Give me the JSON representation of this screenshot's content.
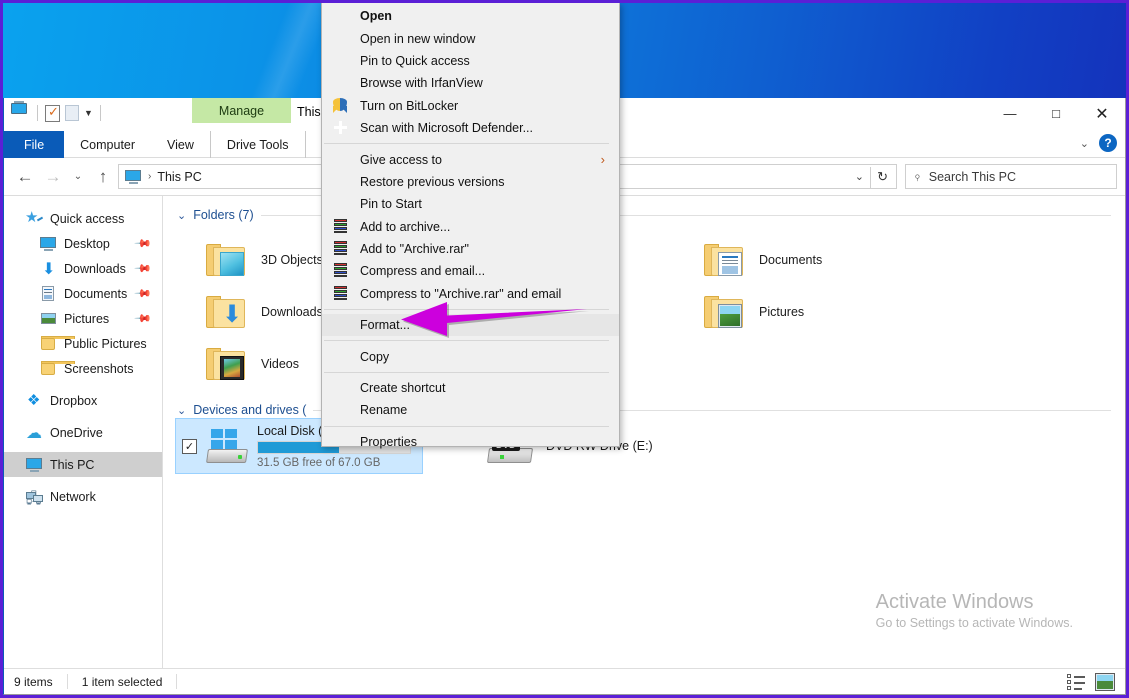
{
  "window": {
    "title": "This PC",
    "title_truncated": "This",
    "contextual_tab_group": "Manage",
    "minimize": "—",
    "maximize": "□",
    "close": "✕",
    "help": "?",
    "ribbon_collapse": "⌄"
  },
  "ribbon": {
    "tabs": [
      {
        "label": "File",
        "id": "file"
      },
      {
        "label": "Computer",
        "id": "computer"
      },
      {
        "label": "View",
        "id": "view"
      },
      {
        "label": "Drive Tools",
        "id": "drive-tools"
      }
    ]
  },
  "quick_access_toolbar": {
    "items": [
      "this-pc-icon",
      "properties-icon",
      "new-folder-icon",
      "customize-chevron-icon"
    ]
  },
  "address_bar": {
    "back": "←",
    "forward": "→",
    "recent": "⌄",
    "up": "↑",
    "crumb_icon": "this-pc-icon",
    "crumb_separator": "›",
    "path": "This PC",
    "dropdown": "⌄",
    "refresh": "↻"
  },
  "search": {
    "icon": "search-icon",
    "placeholder": "Search This PC"
  },
  "sidebar": {
    "items": [
      {
        "label": "Quick access",
        "icon": "star-icon",
        "indent": false,
        "pinned": false,
        "selected": false
      },
      {
        "label": "Desktop",
        "icon": "desktop-icon",
        "indent": true,
        "pinned": true,
        "selected": false
      },
      {
        "label": "Downloads",
        "icon": "download-icon",
        "indent": true,
        "pinned": true,
        "selected": false
      },
      {
        "label": "Documents",
        "icon": "documents-icon",
        "indent": true,
        "pinned": true,
        "selected": false
      },
      {
        "label": "Pictures",
        "icon": "pictures-icon",
        "indent": true,
        "pinned": true,
        "selected": false
      },
      {
        "label": "Public Pictures",
        "icon": "folder-icon",
        "indent": true,
        "pinned": false,
        "selected": false
      },
      {
        "label": "Screenshots",
        "icon": "folder-icon",
        "indent": true,
        "pinned": false,
        "selected": false
      },
      {
        "label": "Dropbox",
        "icon": "dropbox-icon",
        "indent": false,
        "pinned": false,
        "selected": false
      },
      {
        "label": "OneDrive",
        "icon": "onedrive-icon",
        "indent": false,
        "pinned": false,
        "selected": false
      },
      {
        "label": "This PC",
        "icon": "this-pc-icon",
        "indent": false,
        "pinned": false,
        "selected": true
      },
      {
        "label": "Network",
        "icon": "network-icon",
        "indent": false,
        "pinned": false,
        "selected": false
      }
    ],
    "pin_glyph": "📌"
  },
  "content": {
    "groups": [
      {
        "id": "folders",
        "label": "Folders (7)",
        "chevron": "⌄"
      },
      {
        "id": "devices",
        "label": "Devices and drives (",
        "chevron": "⌄"
      }
    ],
    "folders": [
      {
        "label": "3D Objects",
        "icon": "folder-3d-objects-icon"
      },
      {
        "label": "Downloads",
        "icon": "folder-downloads-icon"
      },
      {
        "label": "Videos",
        "icon": "folder-videos-icon"
      },
      {
        "label": "Documents",
        "icon": "folder-documents-icon"
      },
      {
        "label": "Pictures",
        "icon": "folder-pictures-icon"
      }
    ],
    "drives": [
      {
        "name": "Local Disk (",
        "free_text": "31.5 GB free of 67.0 GB",
        "used_percent": 53,
        "selected": true,
        "checkbox": "✓",
        "icon": "hard-disk-icon"
      },
      {
        "name": "DVD RW Drive (E:)",
        "icon": "dvd-drive-icon",
        "badge": "DVD",
        "selected": false
      }
    ]
  },
  "context_menu": {
    "items": [
      {
        "label": "Open",
        "bold": true,
        "icon": null,
        "submenu": false,
        "highlight": false
      },
      {
        "label": "Open in new window",
        "bold": false,
        "icon": null,
        "submenu": false,
        "highlight": false
      },
      {
        "label": "Pin to Quick access",
        "bold": false,
        "icon": null,
        "submenu": false,
        "highlight": false
      },
      {
        "label": "Browse with IrfanView",
        "bold": false,
        "icon": null,
        "submenu": false,
        "highlight": false
      },
      {
        "label": "Turn on BitLocker",
        "bold": false,
        "icon": "bitlocker-shield-icon",
        "submenu": false,
        "highlight": false
      },
      {
        "label": "Scan with Microsoft Defender...",
        "bold": false,
        "icon": "defender-icon",
        "submenu": false,
        "highlight": false
      },
      {
        "separator": true
      },
      {
        "label": "Give access to",
        "bold": false,
        "icon": null,
        "submenu": true,
        "submenu_arrow": "›",
        "highlight": false
      },
      {
        "label": "Restore previous versions",
        "bold": false,
        "icon": null,
        "submenu": false,
        "highlight": false
      },
      {
        "label": "Pin to Start",
        "bold": false,
        "icon": null,
        "submenu": false,
        "highlight": false
      },
      {
        "label": "Add to archive...",
        "bold": false,
        "icon": "winrar-icon",
        "submenu": false,
        "highlight": false
      },
      {
        "label": "Add to \"Archive.rar\"",
        "bold": false,
        "icon": "winrar-icon",
        "submenu": false,
        "highlight": false
      },
      {
        "label": "Compress and email...",
        "bold": false,
        "icon": "winrar-icon",
        "submenu": false,
        "highlight": false
      },
      {
        "label": "Compress to \"Archive.rar\" and email",
        "bold": false,
        "icon": "winrar-icon",
        "submenu": false,
        "highlight": false
      },
      {
        "separator": true
      },
      {
        "label": "Format...",
        "bold": false,
        "icon": null,
        "submenu": false,
        "highlight": true
      },
      {
        "separator": true
      },
      {
        "label": "Copy",
        "bold": false,
        "icon": null,
        "submenu": false,
        "highlight": false
      },
      {
        "separator": true
      },
      {
        "label": "Create shortcut",
        "bold": false,
        "icon": null,
        "submenu": false,
        "highlight": false
      },
      {
        "label": "Rename",
        "bold": false,
        "icon": null,
        "submenu": false,
        "highlight": false
      },
      {
        "separator": true
      },
      {
        "label": "Properties",
        "bold": false,
        "icon": null,
        "submenu": false,
        "highlight": false
      }
    ]
  },
  "annotation": {
    "arrow_color": "#cc00dd",
    "points_to": "Format..."
  },
  "watermark": {
    "line1": "Activate Windows",
    "line2": "Go to Settings to activate Windows."
  },
  "status_bar": {
    "item_count": "9 items",
    "selection": "1 item selected",
    "view_details_icon": "details-view-icon",
    "view_thumbs_icon": "large-icons-view-icon"
  },
  "colors": {
    "accent_blue": "#0a5bb8",
    "contextual_green": "#c5e8a5",
    "selection_blue": "#cce8ff",
    "arrow_magenta": "#cc00dd",
    "frame_purple": "#5b1fd6"
  }
}
